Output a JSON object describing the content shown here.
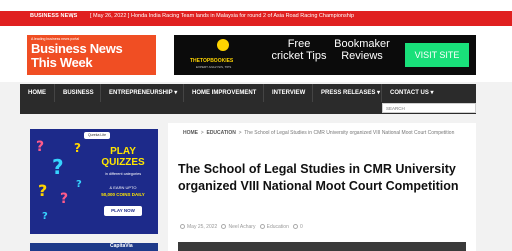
{
  "ticker": {
    "label": "BUSINESS NEWS",
    "separator": "|",
    "date": "[ May 26, 2022 ]",
    "headline": "Honda India Racing Team lands in Malaysia for round 2 of Asia Road Racing Championship"
  },
  "logo": {
    "tagline": "A leading business news portal",
    "line1": "Business News",
    "line2": "This Week",
    "color": "#f04e23"
  },
  "ad_banner": {
    "brand": "THETOPBOOKIES",
    "brand_sub": "EXPERT ANALYSIS, TIPS",
    "text1": "Free cricket Tips",
    "text2": "Bookmaker Reviews",
    "button": "VISIT SITE",
    "button_color": "#19e07a"
  },
  "nav": {
    "items": [
      {
        "label": "HOME"
      },
      {
        "label": "BUSINESS"
      },
      {
        "label": "ENTREPRENEURSHIP ▾"
      },
      {
        "label": "HOME IMPROVEMENT"
      },
      {
        "label": "INTERVIEW"
      },
      {
        "label": "PRESS RELEASES ▾"
      },
      {
        "label": "CONTACT US ▾"
      }
    ],
    "search_placeholder": "SEARCH"
  },
  "sidebar_ad": {
    "badge": "Qureka Lite",
    "headline_line1": "PLAY",
    "headline_line2": "QUIZZES",
    "categories": "in different categories",
    "earn": "& EARN UPTO",
    "coins": "50,000 COINS DAILY",
    "button": "PLAY NOW"
  },
  "sidebar_ad2": {
    "text": "CapitaVia"
  },
  "article": {
    "breadcrumb": {
      "home": "HOME",
      "separator": ">",
      "category": "EDUCATION",
      "current": "The School of Legal Studies in CMR University organized VIII National Moot Court Competition"
    },
    "title": "The School of Legal Studies in CMR University organized VIII National Moot Court Competition",
    "date": "May 25, 2022",
    "author": "Neel Achary",
    "category": "Education",
    "comments": "0"
  }
}
